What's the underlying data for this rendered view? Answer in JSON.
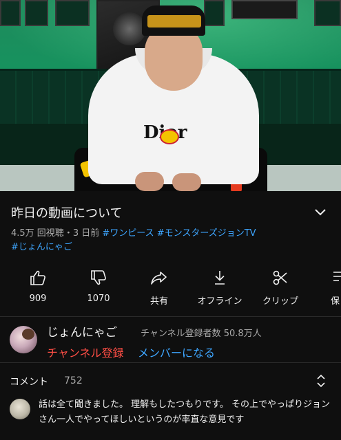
{
  "video": {
    "thumbnail_icon": "person-in-hoodie-video-frame",
    "print_text": "Dior"
  },
  "info": {
    "title": "昨日の動画について",
    "views": "4.5万 回視聴",
    "age": "・3 日前",
    "hashtags": [
      "#ワンピース",
      "#モンスターズジョンTV",
      "#じょんにゃご"
    ]
  },
  "actions": [
    {
      "icon": "thumbs-up-icon",
      "label": "909"
    },
    {
      "icon": "thumbs-down-icon",
      "label": "1070"
    },
    {
      "icon": "share-icon",
      "label": "共有"
    },
    {
      "icon": "download-icon",
      "label": "オフライン"
    },
    {
      "icon": "scissors-icon",
      "label": "クリップ"
    },
    {
      "icon": "save-to-playlist-icon",
      "label": "保"
    }
  ],
  "channel": {
    "name": "じょんにゃご",
    "subscribers": "チャンネル登録者数 50.8万人",
    "subscribe_label": "チャンネル登録",
    "join_label": "メンバーになる"
  },
  "comments": {
    "heading": "コメント",
    "count": "752",
    "top_comment": "話は全て聞きました。 理解もしたつもりです。 その上でやっぱりジョンさん一人でやってほしいというのが率直な意見です"
  },
  "colors": {
    "background": "#0f0f0f",
    "link_blue": "#3ea6ff",
    "subscribe_red": "#ff4e45",
    "secondary_text": "#aaaaaa"
  }
}
